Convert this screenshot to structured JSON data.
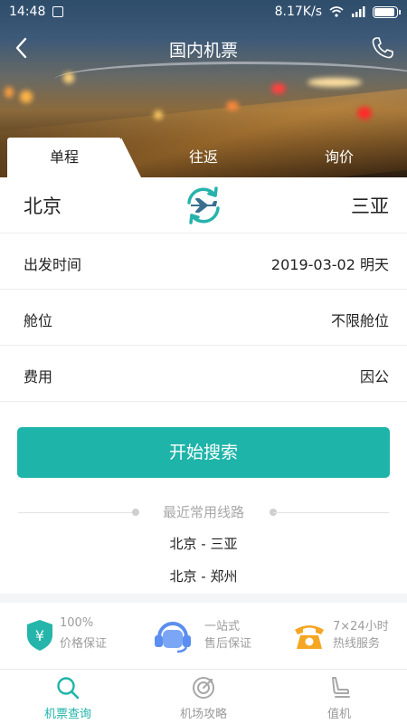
{
  "status_bar": {
    "time": "14:48",
    "network_speed": "8.17K/s"
  },
  "header": {
    "title": "国内机票"
  },
  "tabs": [
    {
      "label": "单程",
      "active": true
    },
    {
      "label": "往返",
      "active": false
    },
    {
      "label": "询价",
      "active": false
    }
  ],
  "route": {
    "from_city": "北京",
    "to_city": "三亚"
  },
  "fields": [
    {
      "label": "出发时间",
      "value": "2019-03-02 明天"
    },
    {
      "label": "舱位",
      "value": "不限舱位"
    },
    {
      "label": "费用",
      "value": "因公"
    }
  ],
  "search_button": "开始搜索",
  "recent": {
    "title": "最近常用线路",
    "routes": [
      "北京 - 三亚",
      "北京 - 郑州"
    ]
  },
  "features": [
    {
      "icon": "shield-yen-icon",
      "line1": "100%",
      "line2": "价格保证",
      "color": "#25b5aa"
    },
    {
      "icon": "headset-icon",
      "line1": "一站式",
      "line2": "售后保证",
      "color": "#5b8ef0"
    },
    {
      "icon": "telephone-icon",
      "line1": "7×24小时",
      "line2": "热线服务",
      "color": "#f5a623"
    }
  ],
  "bottom_nav": [
    {
      "icon": "search-icon",
      "label": "机票查询",
      "active": true
    },
    {
      "icon": "target-icon",
      "label": "机场攻略",
      "active": false
    },
    {
      "icon": "seat-icon",
      "label": "值机",
      "active": false
    }
  ],
  "colors": {
    "accent": "#1fb4a9",
    "text": "#222222",
    "muted": "#9c9c9c"
  }
}
